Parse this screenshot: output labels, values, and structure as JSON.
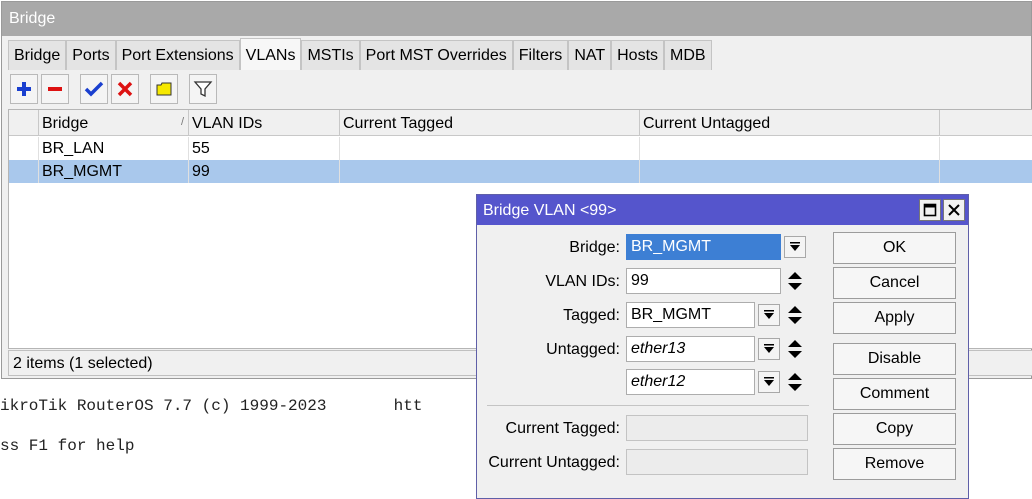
{
  "terminal": {
    "line1": "ikroTik RouterOS 7.7 (c) 1999-2023       htt",
    "line2": "ss F1 for help"
  },
  "window": {
    "title": "Bridge",
    "tabs": [
      "Bridge",
      "Ports",
      "Port Extensions",
      "VLANs",
      "MSTIs",
      "Port MST Overrides",
      "Filters",
      "NAT",
      "Hosts",
      "MDB"
    ],
    "active_tab": "VLANs"
  },
  "toolbar": {
    "icons": [
      "plus-icon",
      "minus-icon",
      "check-icon",
      "cross-icon",
      "comment-icon",
      "filter-icon"
    ]
  },
  "table": {
    "columns": [
      "Bridge",
      "VLAN IDs",
      "Current Tagged",
      "Current Untagged"
    ],
    "rows": [
      {
        "bridge": "BR_LAN",
        "vlan_ids": "55",
        "current_tagged": "",
        "current_untagged": ""
      },
      {
        "bridge": "BR_MGMT",
        "vlan_ids": "99",
        "current_tagged": "",
        "current_untagged": ""
      }
    ],
    "selected_row": 1
  },
  "status": {
    "text": "2 items (1 selected)"
  },
  "dialog": {
    "title": "Bridge VLAN <99>",
    "labels": {
      "bridge": "Bridge:",
      "vlan_ids": "VLAN IDs:",
      "tagged": "Tagged:",
      "untagged": "Untagged:",
      "current_tagged": "Current Tagged:",
      "current_untagged": "Current Untagged:"
    },
    "values": {
      "bridge": "BR_MGMT",
      "vlan_ids": "99",
      "tagged": "BR_MGMT",
      "untagged_1": "ether13",
      "untagged_2": "ether12",
      "current_tagged": "",
      "current_untagged": ""
    },
    "buttons": {
      "ok": "OK",
      "cancel": "Cancel",
      "apply": "Apply",
      "disable": "Disable",
      "comment": "Comment",
      "copy": "Copy",
      "remove": "Remove"
    },
    "colors": {
      "title_bg": "#5555cc",
      "selection": "#3d7fd4"
    }
  }
}
